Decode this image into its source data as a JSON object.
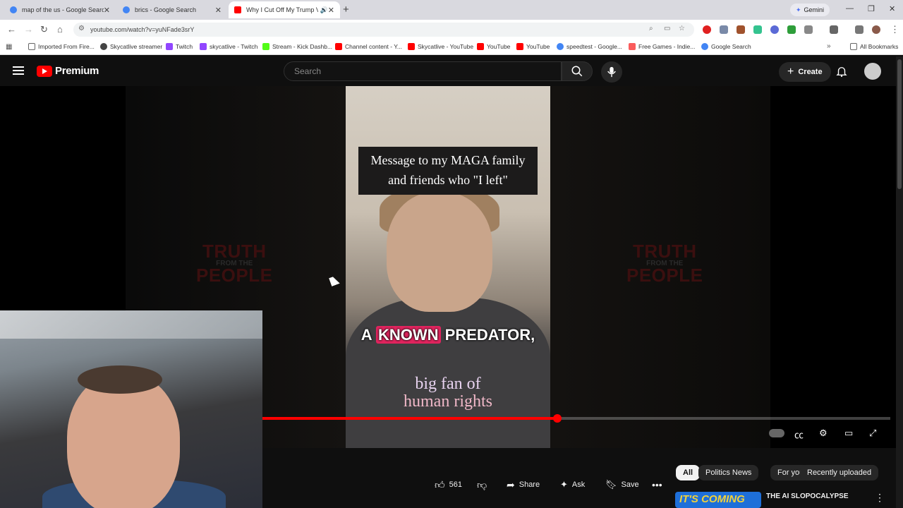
{
  "browser": {
    "tabs": [
      {
        "title": "map of the us - Google Search",
        "favicon_color": "#4285f4"
      },
      {
        "title": "brics - Google Search",
        "favicon_color": "#4285f4"
      },
      {
        "title": "Why I Cut Off My Trump Vo",
        "favicon_color": "#ff0000",
        "active": true
      }
    ],
    "new_tab_label": "+",
    "gemini_label": "Gemini",
    "url": "youtube.com/watch?v=yuNFade3srY",
    "bookmarks": [
      {
        "label": "Imported From Fire...",
        "color": "#666"
      },
      {
        "label": "Skycatlive streamer",
        "color": "#444"
      },
      {
        "label": "Twitch",
        "color": "#9146ff"
      },
      {
        "label": "skycatlive - Twitch",
        "color": "#9146ff"
      },
      {
        "label": "Stream - Kick Dashb...",
        "color": "#53fc18"
      },
      {
        "label": "Channel content - Y...",
        "color": "#ff0000"
      },
      {
        "label": "Skycatlive - YouTube",
        "color": "#ff0000"
      },
      {
        "label": "YouTube",
        "color": "#ff0000"
      },
      {
        "label": "YouTube",
        "color": "#ff0000"
      },
      {
        "label": "speedtest - Google...",
        "color": "#4285f4"
      },
      {
        "label": "Free Games - Indie...",
        "color": "#fa5c5c"
      },
      {
        "label": "Google Search",
        "color": "#4285f4"
      }
    ],
    "all_bookmarks_label": "All Bookmarks"
  },
  "youtube": {
    "logo_text": "Premium",
    "search_placeholder": "Search",
    "create_label": "Create",
    "video": {
      "caption": "Message to my MAGA family and friends who \"I left\"",
      "subtitle_before": "A",
      "subtitle_highlight": "KNOWN",
      "subtitle_after": "PREDATOR,",
      "shirt_line1": "big fan of",
      "shirt_line2": "human rights",
      "watermark_line1": "TRUTH",
      "watermark_line2": "FROM THE",
      "watermark_line3": "PEOPLE",
      "progress": 0.47
    },
    "actions": {
      "like_count": "561",
      "share_label": "Share",
      "ask_label": "Ask",
      "save_label": "Save"
    },
    "chips": [
      "All",
      "Politics News",
      "For you",
      "Recently uploaded"
    ],
    "recommendation": {
      "thumb_text": "IT'S COMING",
      "title": "THE AI SLOPOCALYPSE"
    }
  },
  "colors": {
    "accent_red": "#ff0000",
    "dark_bg": "#0f0f0f",
    "subtitle_highlight": "#e0245e"
  }
}
